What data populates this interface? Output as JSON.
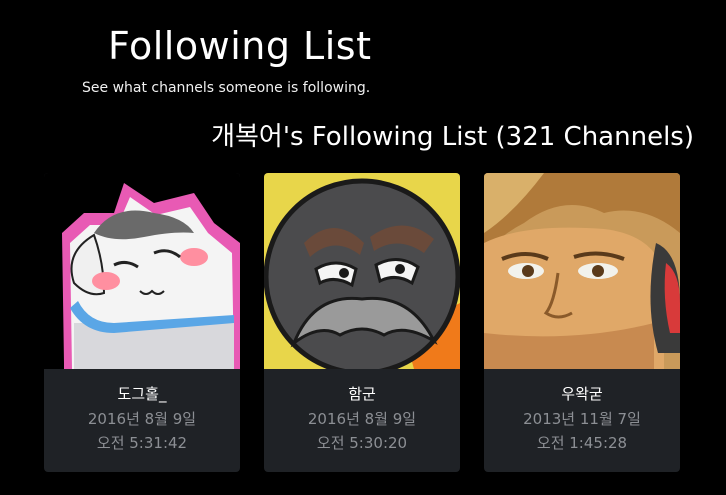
{
  "header": {
    "title": "Following List",
    "subtitle": "See what channels someone is following."
  },
  "list": {
    "heading": "개복어's Following List (321 Channels)"
  },
  "channels": [
    {
      "name": "도그홀_",
      "date": "2016년 8월 9일",
      "time": "오전 5:31:42",
      "avatar": "cartoon-cat-avatar"
    },
    {
      "name": "함군",
      "date": "2016년 8월 9일",
      "time": "오전 5:30:20",
      "avatar": "cartoon-mustache-ball-avatar"
    },
    {
      "name": "우왁굳",
      "date": "2013년 11월 7일",
      "time": "오전 1:45:28",
      "avatar": "cartoon-man-headphones-avatar"
    }
  ],
  "colors": {
    "background": "#000000",
    "card": "#1f2226",
    "muted_text": "#8c8f94"
  }
}
